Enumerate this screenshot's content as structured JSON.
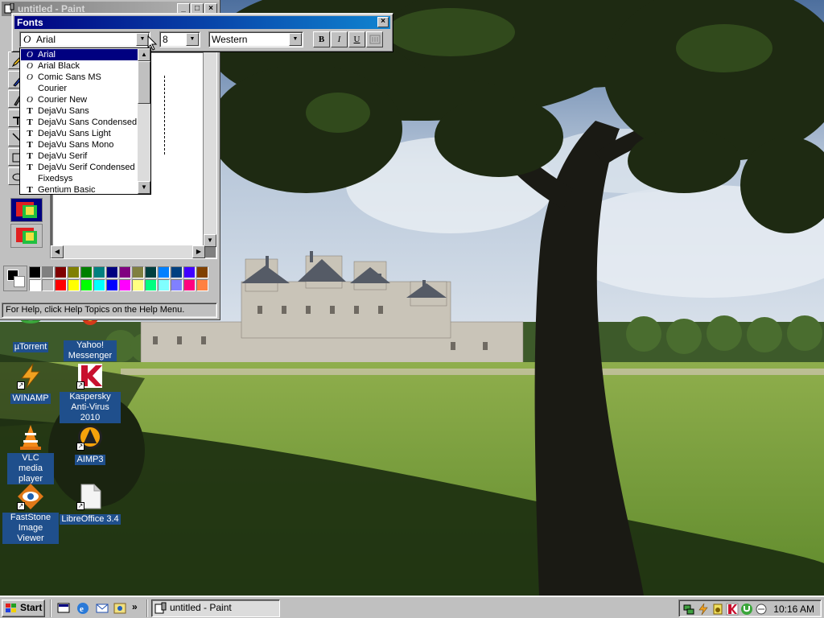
{
  "paint": {
    "title": "untitled - Paint",
    "status": "For Help, click Help Topics on the Help Menu.",
    "palette_top": [
      "#000000",
      "#808080",
      "#800000",
      "#808000",
      "#008000",
      "#008080",
      "#000080",
      "#800080",
      "#808040",
      "#004040",
      "#0080ff",
      "#004080",
      "#4000ff",
      "#804000"
    ],
    "palette_bottom": [
      "#ffffff",
      "#c0c0c0",
      "#ff0000",
      "#ffff00",
      "#00ff00",
      "#00ffff",
      "#0000ff",
      "#ff00ff",
      "#ffff80",
      "#00ff80",
      "#80ffff",
      "#8080ff",
      "#ff0080",
      "#ff8040"
    ]
  },
  "fonts_toolbar": {
    "title": "Fonts",
    "font_name": "Arial",
    "font_size": "8",
    "script": "Western",
    "bold_label": "B",
    "italic_label": "I",
    "underline_label": "U"
  },
  "font_list": {
    "items": [
      {
        "label": "Arial",
        "type": "O"
      },
      {
        "label": "Arial Black",
        "type": "O"
      },
      {
        "label": "Comic Sans MS",
        "type": "O"
      },
      {
        "label": "Courier",
        "type": ""
      },
      {
        "label": "Courier New",
        "type": "O"
      },
      {
        "label": "DejaVu Sans",
        "type": "T"
      },
      {
        "label": "DejaVu Sans Condensed",
        "type": "T"
      },
      {
        "label": "DejaVu Sans Light",
        "type": "T"
      },
      {
        "label": "DejaVu Sans Mono",
        "type": "T"
      },
      {
        "label": "DejaVu Serif",
        "type": "T"
      },
      {
        "label": "DejaVu Serif Condensed",
        "type": "T"
      },
      {
        "label": "Fixedsys",
        "type": ""
      },
      {
        "label": "Gentium Basic",
        "type": "T"
      }
    ],
    "selected": "Arial"
  },
  "desktop_icons": [
    {
      "label": "µTorrent",
      "icon": "utorrent-icon"
    },
    {
      "label": "Yahoo! Messenger",
      "icon": "yahoo-messenger-icon"
    },
    {
      "label": "WINAMP",
      "icon": "winamp-icon"
    },
    {
      "label": "Kaspersky Anti-Virus 2010",
      "icon": "kaspersky-icon"
    },
    {
      "label": "VLC media player",
      "icon": "vlc-icon"
    },
    {
      "label": "AIMP3",
      "icon": "aimp-icon"
    },
    {
      "label": "FastStone Image Viewer",
      "icon": "faststone-icon"
    },
    {
      "label": "LibreOffice 3.4",
      "icon": "libreoffice-icon"
    }
  ],
  "taskbar": {
    "start_label": "Start",
    "task_label": "untitled - Paint",
    "chevron": "»",
    "clock": "10:16 AM"
  }
}
